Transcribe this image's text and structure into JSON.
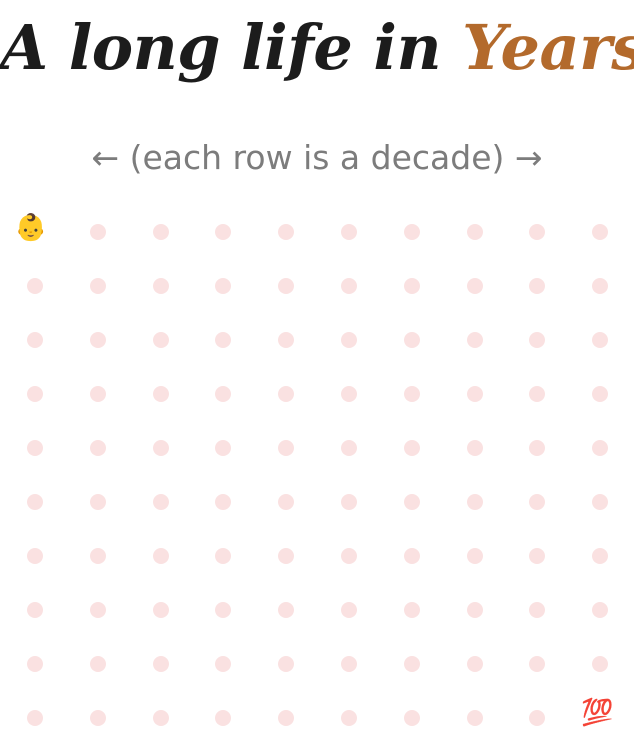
{
  "title": {
    "prefix": "A long life in",
    "accent_word": "Years",
    "accent_color": "#b36a2c"
  },
  "subtitle": "← (each row is a decade) →",
  "grid": {
    "rows": 10,
    "cols": 10,
    "dot_color": "#fae1e1",
    "first_year_marker": "👶",
    "last_year_marker": "💯"
  }
}
